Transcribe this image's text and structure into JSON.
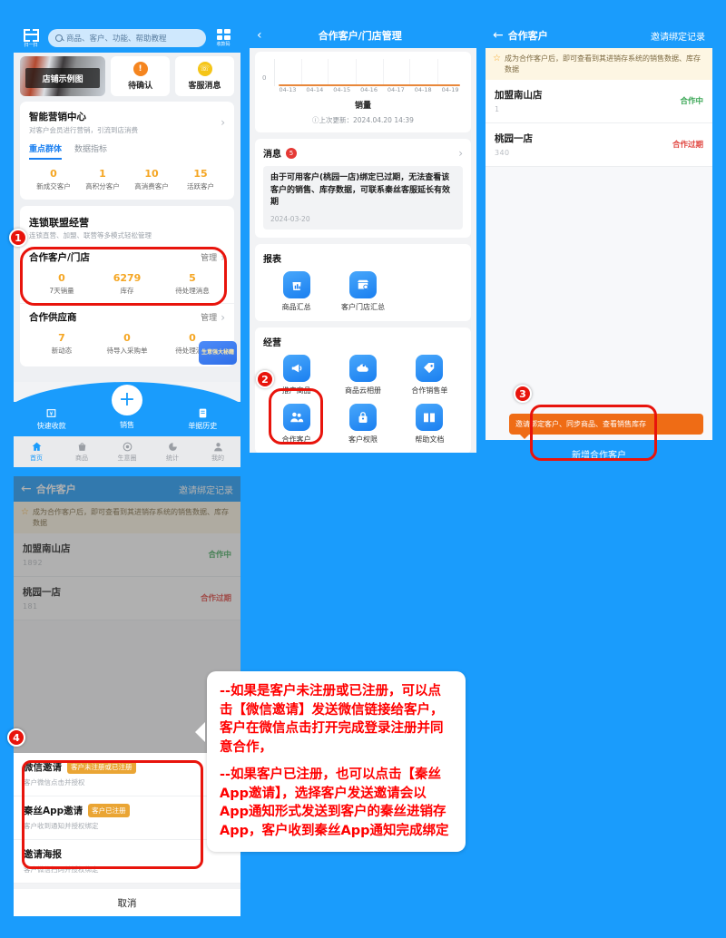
{
  "panel1": {
    "name": "home-screen",
    "topbar": {
      "scan_label": "扫一扫",
      "search_placeholder": "商品、客户、功能、帮助教程",
      "qr_label": "收款码"
    },
    "shop_caption": "店铺示例图",
    "tiles": [
      {
        "icon": "clock-icon",
        "glyph": "⏱",
        "label": "待确认",
        "color": "#f5851f"
      },
      {
        "icon": "headset-icon",
        "glyph": "☎",
        "label": "客服消息",
        "color": "#f5c518"
      }
    ],
    "marketing": {
      "title": "智能营销中心",
      "subtitle": "对客户会员进行营销，引流到店消费",
      "tabs": [
        {
          "label": "重点群体",
          "active": true
        },
        {
          "label": "数据指标",
          "active": false
        }
      ],
      "stats": [
        {
          "value": "0",
          "label": "新成交客户"
        },
        {
          "value": "1",
          "label": "高积分客户"
        },
        {
          "value": "10",
          "label": "高消费客户"
        },
        {
          "value": "15",
          "label": "活跃客户"
        }
      ]
    },
    "alliance": {
      "title": "连锁联盟经营",
      "subtitle": "连锁直营、加盟、联营等多模式轻松管理",
      "blocks": [
        {
          "title": "合作客户/门店",
          "manage": "管理",
          "stats": [
            {
              "value": "0",
              "label": "7天销量"
            },
            {
              "value": "6279",
              "label": "库存"
            },
            {
              "value": "5",
              "label": "待处理消息"
            }
          ]
        },
        {
          "title": "合作供应商",
          "manage": "管理",
          "stats": [
            {
              "value": "7",
              "label": "新动态"
            },
            {
              "value": "0",
              "label": "待导入采购单"
            },
            {
              "value": "0",
              "label": "待处理消息"
            }
          ]
        }
      ]
    },
    "promo_badge": "生意强大秘籍",
    "quickbar": [
      {
        "label": "快速收款",
        "icon": "cash-icon"
      },
      {
        "label": "销售",
        "icon": "plus-icon"
      },
      {
        "label": "单据历史",
        "icon": "clipboard-icon"
      }
    ],
    "tabbar": [
      {
        "label": "首页",
        "icon": "home-icon",
        "active": true
      },
      {
        "label": "商品",
        "icon": "bag-icon",
        "active": false
      },
      {
        "label": "生意圈",
        "icon": "circle-icon",
        "active": false
      },
      {
        "label": "统计",
        "icon": "pie-icon",
        "active": false
      },
      {
        "label": "我的",
        "icon": "person-icon",
        "active": false
      }
    ]
  },
  "panel2": {
    "name": "partner-store-management",
    "nav": {
      "back": "‹",
      "title": "合作客户/门店管理"
    },
    "chart_data": {
      "type": "line",
      "title": "销量",
      "x": [
        "04-13",
        "04-14",
        "04-15",
        "04-16",
        "04-17",
        "04-18",
        "04-19"
      ],
      "values": [
        0,
        0,
        0,
        0,
        0,
        0,
        0
      ],
      "ylim": [
        0,
        1
      ],
      "yticks": [
        "0"
      ],
      "xlabel": "",
      "ylabel": "",
      "series_color": "#e8873a",
      "grid": true,
      "legend": "none",
      "update_text": "ⓘ上次更新：2024.04.20 14:39"
    },
    "message": {
      "header": "消息",
      "badge": "5",
      "body": "由于可用客户(桃园一店)绑定已过期，无法查看该客户的销售、库存数据，可联系秦丝客服延长有效期",
      "date": "2024-03-20"
    },
    "report": {
      "title": "报表",
      "items": [
        {
          "label": "商品汇总",
          "icon": "bag-chart-icon"
        },
        {
          "label": "客户门店汇总",
          "icon": "store-clock-icon"
        }
      ]
    },
    "operate": {
      "title": "经营",
      "items": [
        {
          "label": "推广商品",
          "icon": "megaphone-icon"
        },
        {
          "label": "商品云相册",
          "icon": "cloud-photo-icon"
        },
        {
          "label": "合作销售单",
          "icon": "tag-icon"
        },
        {
          "label": "合作客户",
          "icon": "people-icon"
        },
        {
          "label": "客户权限",
          "icon": "lock-icon"
        },
        {
          "label": "帮助文档",
          "icon": "book-icon"
        }
      ]
    }
  },
  "panel3": {
    "name": "partner-customer-list",
    "nav": {
      "back": "←",
      "title": "合作客户",
      "action": "邀请绑定记录"
    },
    "notice": {
      "icon": "star-icon",
      "text": "成为合作客户后，即可查看到其进销存系统的销售数据、库存数据"
    },
    "clients": [
      {
        "name": "加盟南山店",
        "phone": "1",
        "status": "合作中",
        "state": "ok"
      },
      {
        "name": "桃园一店",
        "phone": "340",
        "status": "合作过期",
        "state": "expired"
      }
    ],
    "tip": "邀请绑定客户、同步商品、查看销售库存",
    "add_button": "新增合作客户"
  },
  "panel4": {
    "name": "invite-action-sheet",
    "nav": {
      "back": "←",
      "title": "合作客户",
      "action": "邀请绑定记录"
    },
    "notice": {
      "icon": "star-icon",
      "text": "成为合作客户后，即可查看到其进销存系统的销售数据、库存数据"
    },
    "clients": [
      {
        "name": "加盟南山店",
        "phone": "1892",
        "status": "合作中",
        "state": "ok"
      },
      {
        "name": "桃园一店",
        "phone": "181",
        "status": "合作过期",
        "state": "expired"
      }
    ],
    "sheet": {
      "items": [
        {
          "title": "微信邀请",
          "tag": "客户未注册或已注册",
          "desc": "客户微信点击并授权"
        },
        {
          "title": "秦丝App邀请",
          "tag": "客户已注册",
          "desc": "客户收到通知并授权绑定"
        },
        {
          "title": "邀请海报",
          "tag": "",
          "desc": "客户微信扫码并授权绑定"
        }
      ],
      "cancel": "取消"
    }
  },
  "annotations": {
    "steps": [
      "1",
      "2",
      "3",
      "4"
    ],
    "callout": [
      "--如果是客户未注册或已注册，可以点击【微信邀请】发送微信链接给客户，客户在微信点击打开完成登录注册并同意合作，",
      "--如果客户已注册，也可以点击【秦丝App邀请】，选择客户发送邀请会以App通知形式发送到客户的秦丝进销存App，客户收到秦丝App通知完成绑定"
    ]
  }
}
